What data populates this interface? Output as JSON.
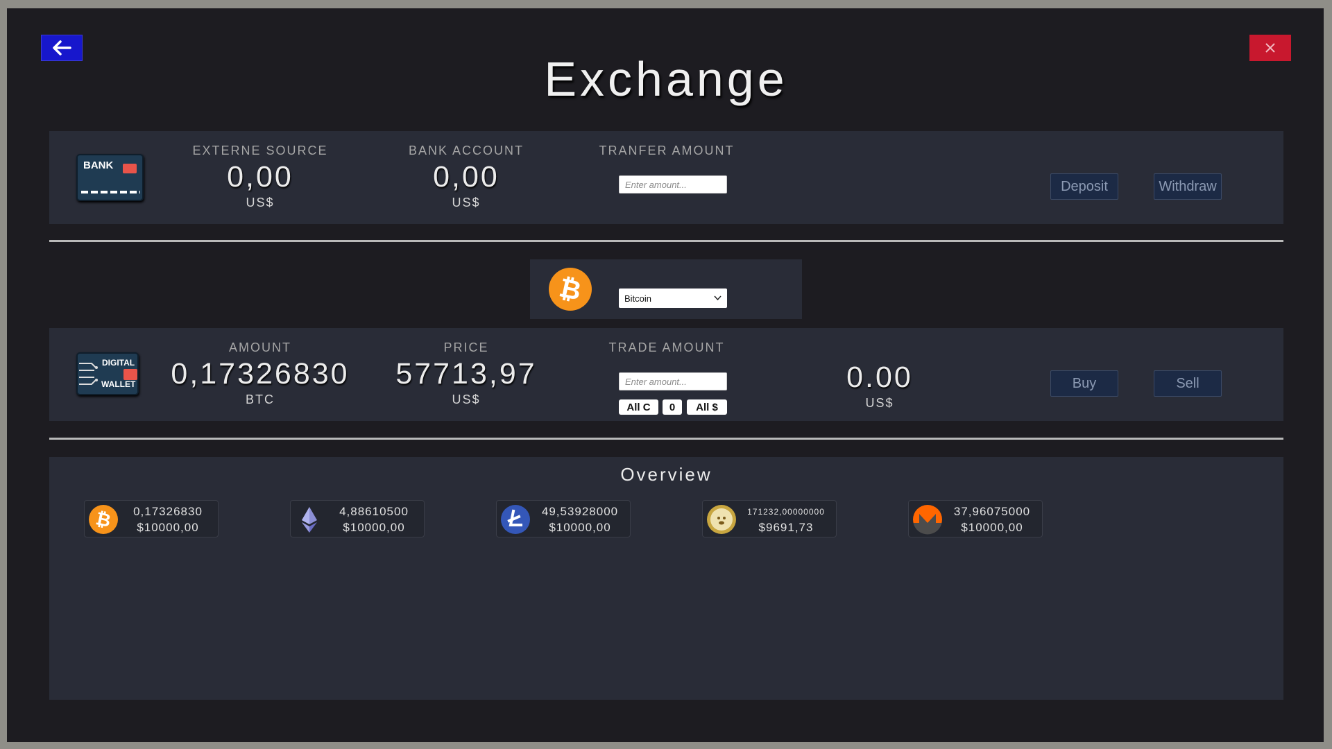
{
  "header": {
    "title": "Exchange"
  },
  "bank": {
    "card_label": "BANK",
    "externe_source": {
      "label": "EXTERNE SOURCE",
      "value": "0,00",
      "unit": "US$"
    },
    "bank_account": {
      "label": "BANK ACCOUNT",
      "value": "0,00",
      "unit": "US$"
    },
    "transfer": {
      "label": "TRANFER AMOUNT",
      "placeholder": "Enter amount..."
    },
    "deposit_label": "Deposit",
    "withdraw_label": "Withdraw"
  },
  "coin_selector": {
    "selected": "Bitcoin"
  },
  "wallet": {
    "icon_label_1": "DIGITAL",
    "icon_label_2": "WALLET",
    "amount": {
      "label": "AMOUNT",
      "value": "0,17326830",
      "unit": "BTC"
    },
    "price": {
      "label": "PRICE",
      "value": "57713,97",
      "unit": "US$"
    },
    "trade": {
      "label": "TRADE AMOUNT",
      "placeholder": "Enter amount..."
    },
    "quick_buttons": {
      "all_coin": "All C",
      "zero": "0",
      "all_usd": "All $"
    },
    "result": {
      "value": "0.00",
      "unit": "US$"
    },
    "buy_label": "Buy",
    "sell_label": "Sell"
  },
  "overview": {
    "title": "Overview",
    "items": [
      {
        "coin": "bitcoin-icon",
        "quantity": "0,17326830",
        "value": "$10000,00"
      },
      {
        "coin": "ethereum-icon",
        "quantity": "4,88610500",
        "value": "$10000,00"
      },
      {
        "coin": "litecoin-icon",
        "quantity": "49,53928000",
        "value": "$10000,00"
      },
      {
        "coin": "dogecoin-icon",
        "quantity": "171232,00000000",
        "value": "$9691,73"
      },
      {
        "coin": "monero-icon",
        "quantity": "37,96075000",
        "value": "$10000,00"
      }
    ]
  },
  "colors": {
    "back_button": "#1717cc",
    "close_button": "#c8182e",
    "bitcoin": "#f7931a",
    "panel": "#292c37",
    "background": "#1d1c21"
  }
}
